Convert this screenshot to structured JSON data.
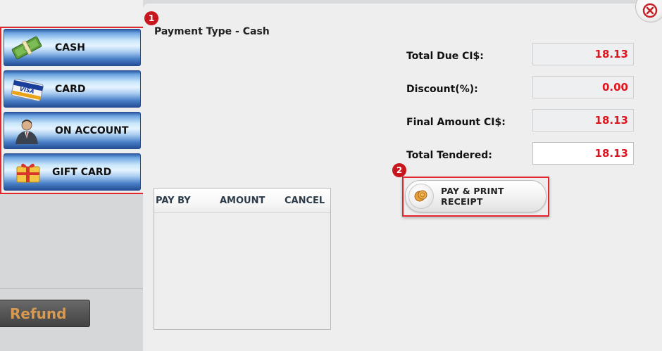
{
  "sidebar": {
    "payment_methods": [
      {
        "id": "cash",
        "label": "CASH",
        "icon": "cash-icon"
      },
      {
        "id": "card",
        "label": "CARD",
        "icon": "visa-card-icon"
      },
      {
        "id": "on_account",
        "label": "ON ACCOUNT",
        "icon": "person-icon"
      },
      {
        "id": "gift_card",
        "label": "GIFT CARD",
        "icon": "gift-card-icon"
      }
    ],
    "refund_label": "Refund"
  },
  "header": {
    "title": "Payment Type - Cash"
  },
  "steps": {
    "one": "1",
    "two": "2"
  },
  "totals": {
    "total_due_label": "Total Due CI$:",
    "total_due_value": "18.13",
    "discount_label": "Discount(%):",
    "discount_value": "0.00",
    "final_amount_label": "Final Amount CI$:",
    "final_amount_value": "18.13",
    "total_tendered_label": "Total Tendered:",
    "total_tendered_value": "18.13"
  },
  "actions": {
    "pay_print_label": "PAY & PRINT RECEIPT",
    "pay_print_icon": "coins-icon",
    "close_icon": "close-icon"
  },
  "payments_table": {
    "columns": [
      "PAY BY",
      "AMOUNT",
      "CANCEL"
    ],
    "rows": []
  },
  "colors": {
    "highlight_red": "#e3262e",
    "value_red": "#e0141c",
    "button_blue": "#4a80c8",
    "refund_text": "#d89a50"
  }
}
